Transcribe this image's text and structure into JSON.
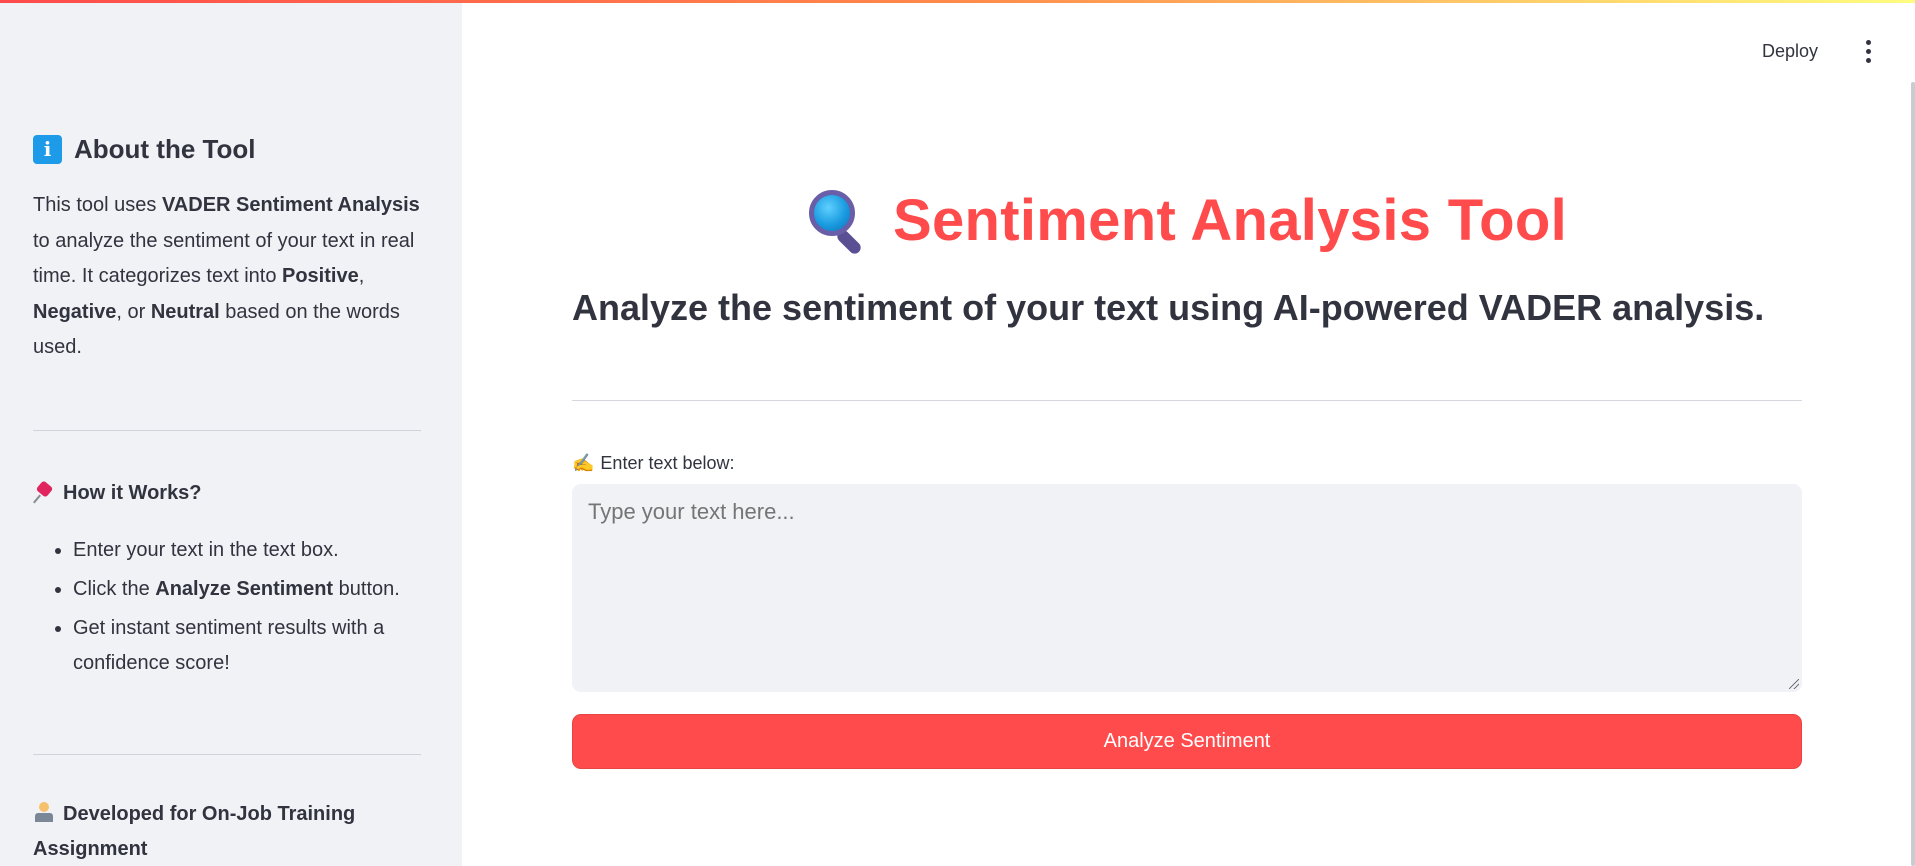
{
  "sidebar": {
    "about": {
      "icon": "info-icon",
      "icon_glyph": "i",
      "title": "About the Tool",
      "text_1": "This tool uses ",
      "text_bold_1": "VADER Sentiment Analysis",
      "text_2": " to analyze the sentiment of your text in real time. It categorizes text into ",
      "text_bold_2": "Positive",
      "text_3": ", ",
      "text_bold_3": "Negative",
      "text_4": ", or ",
      "text_bold_4": "Neutral",
      "text_5": " based on the words used."
    },
    "how": {
      "icon": "pushpin-icon",
      "title": "How it Works?",
      "items": [
        {
          "text": "Enter your text in the text box."
        },
        {
          "text_pre": "Click the ",
          "text_bold": "Analyze Sentiment",
          "text_post": " button."
        },
        {
          "text": "Get instant sentiment results with a confidence score!"
        }
      ]
    },
    "developer": {
      "icon": "technologist-icon",
      "title": "Developed for On-Job Training Assignment"
    }
  },
  "header": {
    "deploy_label": "Deploy",
    "menu_icon": "more-vertical-icon"
  },
  "main": {
    "title_icon": "magnifier-icon",
    "title": "Sentiment Analysis Tool",
    "subtitle": "Analyze the sentiment of your text using AI-powered VADER analysis.",
    "input_icon": "writing-hand-icon",
    "input_icon_glyph": "✍️",
    "input_label": "Enter text below:",
    "input_value": "",
    "input_placeholder": "Type your text here...",
    "button_label": "Analyze Sentiment"
  },
  "colors": {
    "accent": "#ff4b4b",
    "sidebar_bg": "#f0f2f6",
    "text": "#31333f"
  }
}
